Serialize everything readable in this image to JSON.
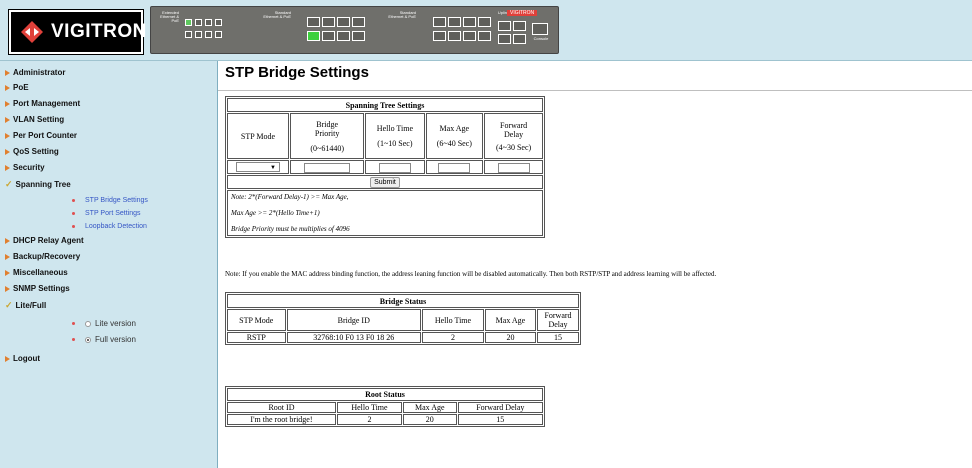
{
  "brand": {
    "name": "VIGITRON",
    "device_brand": "VIGITRON"
  },
  "device": {
    "label_extended": "Extended\nEthernet\n& PoE",
    "label_standard": "Standard\nEthernet\n& PoE",
    "label_uplink": "Uplink",
    "label_console": "Console",
    "top_ports_a": [
      "1",
      "3",
      "5",
      "7"
    ],
    "bottom_ports_a": [
      "2",
      "4",
      "6",
      "8"
    ],
    "top_ports_b": [
      "9",
      "11",
      "13",
      "15"
    ],
    "bottom_ports_b": [
      "10",
      "12",
      "14",
      "16"
    ],
    "top_ports_c": [
      "17",
      "19",
      "21",
      "23"
    ],
    "bottom_ports_c": [
      "18",
      "20",
      "22",
      "24"
    ],
    "uplink_top": [
      "25",
      "26"
    ],
    "uplink_bottom": [
      "27",
      "28"
    ]
  },
  "sidebar": {
    "items": [
      {
        "label": "Administrator"
      },
      {
        "label": "PoE"
      },
      {
        "label": "Port Management"
      },
      {
        "label": "VLAN Setting"
      },
      {
        "label": "Per Port Counter"
      },
      {
        "label": "QoS Setting"
      },
      {
        "label": "Security"
      },
      {
        "label": "Spanning Tree"
      },
      {
        "label": "DHCP Relay Agent"
      },
      {
        "label": "Backup/Recovery"
      },
      {
        "label": "Miscellaneous"
      },
      {
        "label": "SNMP Settings"
      },
      {
        "label": "Lite/Full"
      },
      {
        "label": "Logout"
      }
    ],
    "spanning_tree_sub": [
      "STP Bridge Settings",
      "STP Port Settings",
      "Loopback Detection"
    ],
    "version_options": [
      "Lite version",
      "Full version"
    ],
    "version_selected": "Full version"
  },
  "page": {
    "title": "STP Bridge Settings"
  },
  "spanning_tree_settings": {
    "caption": "Spanning Tree Settings",
    "headers": {
      "stp_mode": "STP Mode",
      "bridge_priority": "Bridge Priority",
      "bridge_priority_range": "(0~61440)",
      "hello_time": "Hello Time",
      "hello_time_range": "(1~10 Sec)",
      "max_age": "Max Age",
      "max_age_range": "(6~40 Sec)",
      "forward_delay": "Forward Delay",
      "forward_delay_range": "(4~30 Sec)"
    },
    "submit_label": "Submit",
    "notes": [
      "Note: 2*(Forward Delay-1) >= Max Age,",
      "Max Age >= 2*(Hello Time+1)",
      "Bridge Priority must be multiplies of 4096"
    ]
  },
  "mac_binding_note": "Note: If you enable the MAC address binding function, the address leaning function will be disabled automatically. Then both RSTP/STP and address learning will be affected.",
  "bridge_status": {
    "caption": "Bridge Status",
    "headers": [
      "STP Mode",
      "Bridge ID",
      "Hello Time",
      "Max Age",
      "Forward Delay"
    ],
    "row": [
      "RSTP",
      "32768:10 F0 13 F0 18 26",
      "2",
      "20",
      "15"
    ]
  },
  "root_status": {
    "caption": "Root Status",
    "headers": [
      "Root ID",
      "Hello Time",
      "Max Age",
      "Forward Delay"
    ],
    "row": [
      "I'm the root bridge!",
      "2",
      "20",
      "15"
    ]
  }
}
